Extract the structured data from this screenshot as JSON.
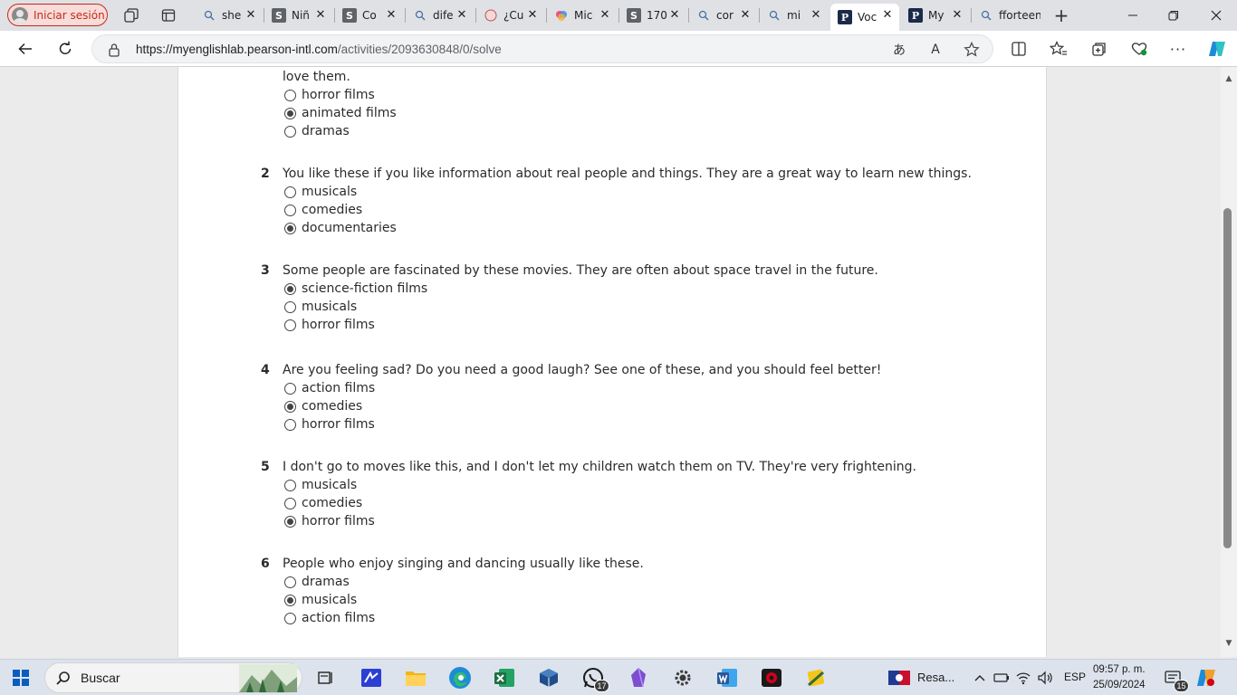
{
  "browser": {
    "profile_label": "Iniciar sesión",
    "tabs": [
      {
        "title": "she",
        "favicon": "search-icon"
      },
      {
        "title": "Niñ",
        "favicon": "S"
      },
      {
        "title": "Co",
        "favicon": "S"
      },
      {
        "title": "dife",
        "favicon": "search-icon"
      },
      {
        "title": "¿Cu",
        "favicon": "site-icon"
      },
      {
        "title": "Mic",
        "favicon": "copilot-icon"
      },
      {
        "title": "170",
        "favicon": "S"
      },
      {
        "title": "cor",
        "favicon": "search-icon"
      },
      {
        "title": "mi",
        "favicon": "search-icon"
      },
      {
        "title": "Voc",
        "favicon": "P",
        "active": true
      },
      {
        "title": "My",
        "favicon": "P"
      },
      {
        "title": "fforteen",
        "favicon": "search-icon"
      }
    ],
    "url_host": "https://myenglishlab.pearson-intl.com",
    "url_path": "/activities/2093630848/0/solve"
  },
  "quiz": {
    "previous_question_tail": "love them.",
    "first_options": [
      {
        "label": "horror films",
        "checked": false
      },
      {
        "label": "animated films",
        "checked": true
      },
      {
        "label": "dramas",
        "checked": false
      }
    ],
    "questions": [
      {
        "number": "2",
        "text": "You like these if you like information about real people and things. They are a great way to learn new things.",
        "options": [
          {
            "label": "musicals",
            "checked": false
          },
          {
            "label": "comedies",
            "checked": false
          },
          {
            "label": "documentaries",
            "checked": true
          }
        ]
      },
      {
        "number": "3",
        "text": "Some people are fascinated by these movies. They are often about space travel in the future.",
        "options": [
          {
            "label": "science-fiction films",
            "checked": true
          },
          {
            "label": "musicals",
            "checked": false
          },
          {
            "label": "horror films",
            "checked": false
          }
        ]
      },
      {
        "number": "4",
        "text": "Are you feeling sad? Do you need a good laugh? See one of these, and you should feel better!",
        "options": [
          {
            "label": "action films",
            "checked": false
          },
          {
            "label": "comedies",
            "checked": true
          },
          {
            "label": "horror films",
            "checked": false
          }
        ]
      },
      {
        "number": "5",
        "text": "I don't go to moves like this, and I don't let my children watch them on TV. They're very frightening.",
        "options": [
          {
            "label": "musicals",
            "checked": false
          },
          {
            "label": "comedies",
            "checked": false
          },
          {
            "label": "horror films",
            "checked": true
          }
        ]
      },
      {
        "number": "6",
        "text": "People who enjoy singing and dancing usually like these.",
        "options": [
          {
            "label": "dramas",
            "checked": false
          },
          {
            "label": "musicals",
            "checked": true
          },
          {
            "label": "action films",
            "checked": false
          }
        ]
      }
    ]
  },
  "taskbar": {
    "search_label": "Buscar",
    "whatsapp_badge": "17",
    "weather_text": "Resa...",
    "language": "ESP",
    "time": "09:57 p. m.",
    "date": "25/09/2024",
    "notifications_count": "15"
  },
  "colors": {
    "profile_accent": "#c42b1c",
    "edge_blue": "#0b5cbf",
    "excel_green": "#1d6f42",
    "word_blue": "#2b579a"
  }
}
